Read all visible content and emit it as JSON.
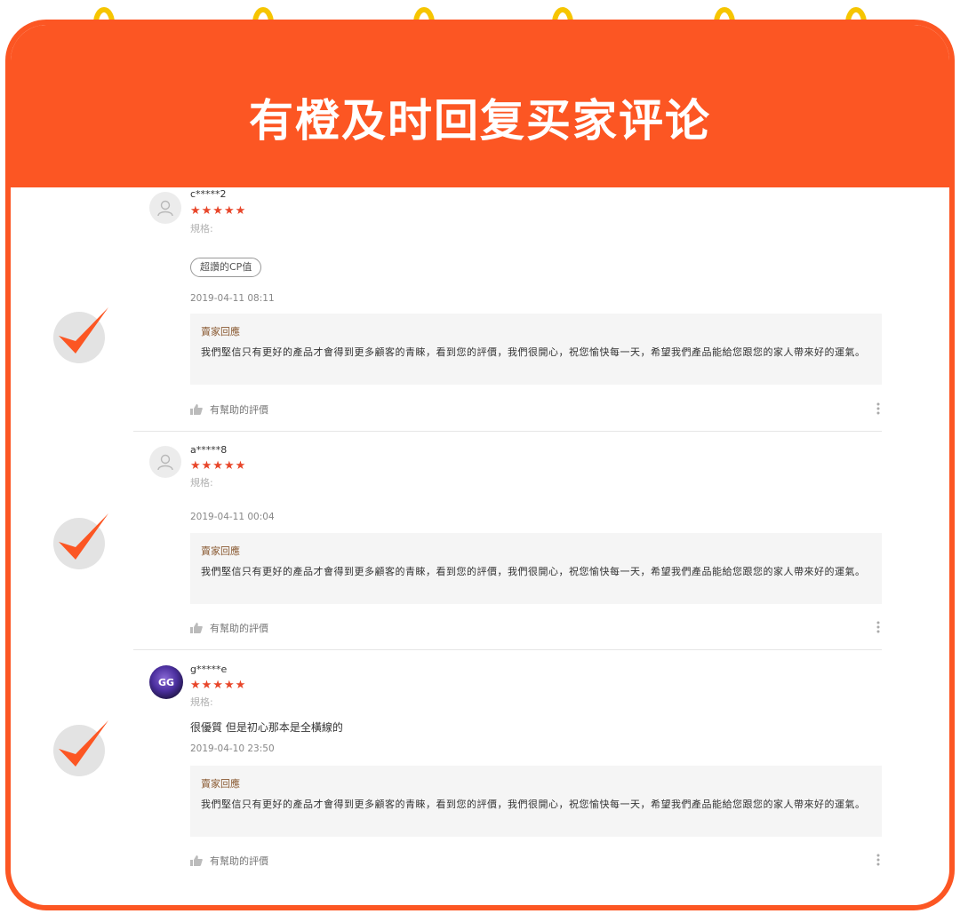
{
  "header": {
    "title": "有橙及时回复买家评论"
  },
  "colors": {
    "accent": "#fc5623",
    "ring": "#f6c500",
    "star": "#e8462a",
    "reply_bg": "#f5f5f5"
  },
  "reviews": [
    {
      "username": "c*****2",
      "stars": "★★★★★",
      "spec": "規格:",
      "tag": "超讚的CP值",
      "comment": "",
      "date": "2019-04-11 08:11",
      "reply_title": "賣家回應",
      "reply_text": "我們堅信只有更好的產品才會得到更多顧客的青睞，看到您的評價，我們很開心，祝您愉快每一天，希望我們產品能給您跟您的家人帶來好的運氣。",
      "helpful": "有幫助的評價",
      "avatar_icon": "user-icon"
    },
    {
      "username": "a*****8",
      "stars": "★★★★★",
      "spec": "規格:",
      "tag": "",
      "comment": "",
      "date": "2019-04-11 00:04",
      "reply_title": "賣家回應",
      "reply_text": "我們堅信只有更好的產品才會得到更多顧客的青睞，看到您的評價，我們很開心，祝您愉快每一天，希望我們產品能給您跟您的家人帶來好的運氣。",
      "helpful": "有幫助的評價",
      "avatar_icon": "user-icon"
    },
    {
      "username": "g*****e",
      "stars": "★★★★★",
      "spec": "規格:",
      "tag": "",
      "comment": "很優質 但是初心那本是全橫線的",
      "date": "2019-04-10 23:50",
      "reply_title": "賣家回應",
      "reply_text": "我們堅信只有更好的產品才會得到更多顧客的青睞，看到您的評價，我們很開心，祝您愉快每一天，希望我們產品能給您跟您的家人帶來好的運氣。",
      "helpful": "有幫助的評價",
      "avatar_icon": "gg-logo-avatar",
      "avatar_text": "GG"
    }
  ]
}
